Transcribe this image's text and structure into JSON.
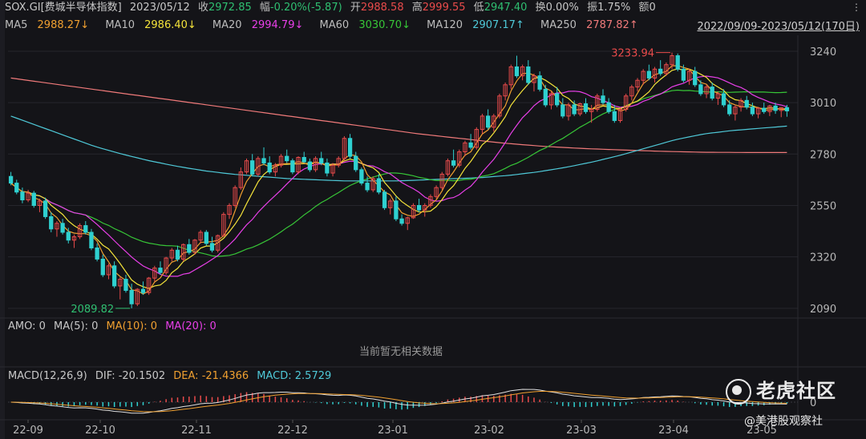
{
  "info": {
    "symbol": "SOX.GI[费城半导体指数]",
    "date": "2023/05/12",
    "close_label": "收",
    "close": "2972.85",
    "change_label": "幅",
    "change": "-0.20%(-5.87)",
    "open_label": "开",
    "open": "2988.58",
    "high_label": "高",
    "high": "2999.55",
    "low_label": "低",
    "low": "2947.40",
    "turnover_label": "换",
    "turnover": "0.00%",
    "amplitude_label": "振",
    "amplitude": "1.75%",
    "amount_label": "额",
    "amount": "0"
  },
  "ma": [
    {
      "label": "MA5",
      "value": "2988.27↓",
      "color": "#f0a030"
    },
    {
      "label": "MA10",
      "value": "2986.40↓",
      "color": "#f3e23a"
    },
    {
      "label": "MA20",
      "value": "2994.79↓",
      "color": "#e83fe8"
    },
    {
      "label": "MA60",
      "value": "3030.70↓",
      "color": "#37c637"
    },
    {
      "label": "MA120",
      "value": "2907.17↑",
      "color": "#4fc9d8"
    },
    {
      "label": "MA250",
      "value": "2787.82↑",
      "color": "#f07a7a"
    }
  ],
  "range": "2022/09/09-2023/05/12(170日)",
  "price_axis": [
    "3240",
    "3010",
    "2780",
    "2550",
    "2320",
    "2090"
  ],
  "annotations": {
    "high": "3233.94",
    "low": "2089.82"
  },
  "amo": {
    "label": "AMO: 0",
    "ma5": "MA(5): 0",
    "ma10": "MA(10): 0",
    "ma20": "MA(20): 0"
  },
  "amo_empty": "当前暂无相关数据",
  "macd": {
    "title": "MACD(12,26,9)",
    "dif": "DIF: -20.1502",
    "dea": "DEA: -21.4366",
    "macd": "MACD: 2.5729",
    "axis_zero": "0"
  },
  "x_axis": [
    "22-09",
    "22-10",
    "22-11",
    "22-12",
    "23-01",
    "23-02",
    "23-03",
    "23-04",
    "23-05"
  ],
  "watermark": {
    "brand": "老虎社区",
    "author": "@美港股观察社"
  },
  "colors": {
    "up": "#e94b4b",
    "down": "#2fd0d0",
    "bg": "#141418"
  },
  "chart_data": {
    "type": "candlestick",
    "ylim": [
      2050,
      3290
    ],
    "candles": [
      [
        2680,
        2700,
        2640,
        2650
      ],
      [
        2650,
        2665,
        2600,
        2610
      ],
      [
        2610,
        2630,
        2560,
        2575
      ],
      [
        2575,
        2620,
        2565,
        2605
      ],
      [
        2605,
        2615,
        2540,
        2550
      ],
      [
        2550,
        2580,
        2520,
        2570
      ],
      [
        2570,
        2585,
        2490,
        2500
      ],
      [
        2500,
        2520,
        2430,
        2445
      ],
      [
        2445,
        2480,
        2410,
        2470
      ],
      [
        2470,
        2490,
        2420,
        2430
      ],
      [
        2430,
        2450,
        2380,
        2395
      ],
      [
        2395,
        2420,
        2360,
        2410
      ],
      [
        2410,
        2470,
        2400,
        2460
      ],
      [
        2460,
        2480,
        2420,
        2430
      ],
      [
        2430,
        2445,
        2350,
        2360
      ],
      [
        2360,
        2380,
        2300,
        2310
      ],
      [
        2310,
        2330,
        2230,
        2240
      ],
      [
        2240,
        2290,
        2220,
        2280
      ],
      [
        2280,
        2300,
        2180,
        2190
      ],
      [
        2190,
        2230,
        2130,
        2220
      ],
      [
        2220,
        2240,
        2160,
        2170
      ],
      [
        2170,
        2200,
        2090,
        2110
      ],
      [
        2110,
        2180,
        2100,
        2175
      ],
      [
        2175,
        2210,
        2150,
        2160
      ],
      [
        2160,
        2230,
        2150,
        2225
      ],
      [
        2225,
        2280,
        2210,
        2270
      ],
      [
        2270,
        2300,
        2240,
        2250
      ],
      [
        2250,
        2320,
        2240,
        2315
      ],
      [
        2315,
        2360,
        2300,
        2350
      ],
      [
        2350,
        2370,
        2300,
        2310
      ],
      [
        2310,
        2380,
        2300,
        2375
      ],
      [
        2375,
        2400,
        2330,
        2340
      ],
      [
        2340,
        2400,
        2330,
        2395
      ],
      [
        2395,
        2440,
        2380,
        2430
      ],
      [
        2430,
        2440,
        2370,
        2380
      ],
      [
        2380,
        2410,
        2340,
        2350
      ],
      [
        2350,
        2420,
        2340,
        2415
      ],
      [
        2415,
        2520,
        2410,
        2510
      ],
      [
        2510,
        2560,
        2490,
        2550
      ],
      [
        2550,
        2640,
        2540,
        2630
      ],
      [
        2630,
        2720,
        2620,
        2700
      ],
      [
        2700,
        2760,
        2690,
        2750
      ],
      [
        2750,
        2780,
        2680,
        2690
      ],
      [
        2690,
        2770,
        2680,
        2760
      ],
      [
        2760,
        2810,
        2730,
        2740
      ],
      [
        2740,
        2770,
        2690,
        2700
      ],
      [
        2700,
        2740,
        2680,
        2730
      ],
      [
        2730,
        2780,
        2720,
        2770
      ],
      [
        2770,
        2800,
        2740,
        2750
      ],
      [
        2750,
        2760,
        2690,
        2700
      ],
      [
        2700,
        2770,
        2690,
        2765
      ],
      [
        2765,
        2790,
        2740,
        2745
      ],
      [
        2745,
        2760,
        2700,
        2710
      ],
      [
        2710,
        2770,
        2700,
        2760
      ],
      [
        2760,
        2790,
        2730,
        2740
      ],
      [
        2740,
        2760,
        2680,
        2695
      ],
      [
        2695,
        2740,
        2680,
        2730
      ],
      [
        2730,
        2770,
        2720,
        2760
      ],
      [
        2760,
        2860,
        2750,
        2850
      ],
      [
        2850,
        2870,
        2760,
        2770
      ],
      [
        2770,
        2790,
        2700,
        2710
      ],
      [
        2710,
        2720,
        2640,
        2650
      ],
      [
        2650,
        2680,
        2610,
        2620
      ],
      [
        2620,
        2680,
        2610,
        2670
      ],
      [
        2670,
        2690,
        2600,
        2610
      ],
      [
        2610,
        2620,
        2530,
        2540
      ],
      [
        2540,
        2580,
        2510,
        2570
      ],
      [
        2570,
        2590,
        2480,
        2490
      ],
      [
        2490,
        2510,
        2460,
        2470
      ],
      [
        2470,
        2500,
        2440,
        2495
      ],
      [
        2495,
        2560,
        2490,
        2550
      ],
      [
        2550,
        2580,
        2520,
        2530
      ],
      [
        2530,
        2560,
        2500,
        2550
      ],
      [
        2550,
        2600,
        2540,
        2590
      ],
      [
        2590,
        2640,
        2580,
        2630
      ],
      [
        2630,
        2700,
        2620,
        2690
      ],
      [
        2690,
        2760,
        2680,
        2750
      ],
      [
        2750,
        2800,
        2720,
        2730
      ],
      [
        2730,
        2800,
        2720,
        2790
      ],
      [
        2790,
        2840,
        2770,
        2830
      ],
      [
        2830,
        2870,
        2800,
        2810
      ],
      [
        2810,
        2900,
        2800,
        2890
      ],
      [
        2890,
        2960,
        2870,
        2950
      ],
      [
        2950,
        2980,
        2890,
        2900
      ],
      [
        2900,
        2960,
        2880,
        2950
      ],
      [
        2950,
        3050,
        2940,
        3040
      ],
      [
        3040,
        3100,
        3020,
        3090
      ],
      [
        3090,
        3180,
        3070,
        3170
      ],
      [
        3170,
        3220,
        3120,
        3130
      ],
      [
        3130,
        3180,
        3110,
        3170
      ],
      [
        3170,
        3200,
        3090,
        3100
      ],
      [
        3100,
        3140,
        3060,
        3130
      ],
      [
        3130,
        3150,
        3060,
        3070
      ],
      [
        3070,
        3090,
        2990,
        3000
      ],
      [
        3000,
        3060,
        2980,
        3050
      ],
      [
        3050,
        3080,
        2990,
        3000
      ],
      [
        3000,
        3030,
        2940,
        2950
      ],
      [
        2950,
        3010,
        2930,
        3000
      ],
      [
        3000,
        3020,
        2950,
        2960
      ],
      [
        2960,
        3010,
        2950,
        3005
      ],
      [
        3005,
        3030,
        2960,
        2970
      ],
      [
        2970,
        3000,
        2920,
        2980
      ],
      [
        2980,
        3050,
        2970,
        3040
      ],
      [
        3040,
        3070,
        3000,
        3010
      ],
      [
        3010,
        3030,
        2960,
        2970
      ],
      [
        2970,
        3000,
        2920,
        2930
      ],
      [
        2930,
        2990,
        2920,
        2980
      ],
      [
        2980,
        3050,
        2970,
        3040
      ],
      [
        3040,
        3090,
        3020,
        3080
      ],
      [
        3080,
        3120,
        3060,
        3110
      ],
      [
        3110,
        3160,
        3090,
        3150
      ],
      [
        3150,
        3180,
        3110,
        3120
      ],
      [
        3120,
        3170,
        3100,
        3160
      ],
      [
        3160,
        3200,
        3130,
        3140
      ],
      [
        3140,
        3190,
        3130,
        3180
      ],
      [
        3180,
        3234,
        3160,
        3220
      ],
      [
        3220,
        3230,
        3150,
        3160
      ],
      [
        3160,
        3180,
        3100,
        3110
      ],
      [
        3110,
        3160,
        3090,
        3150
      ],
      [
        3150,
        3170,
        3080,
        3090
      ],
      [
        3090,
        3110,
        3040,
        3050
      ],
      [
        3050,
        3090,
        3030,
        3080
      ],
      [
        3080,
        3100,
        3020,
        3030
      ],
      [
        3030,
        3060,
        3000,
        3050
      ],
      [
        3050,
        3070,
        2990,
        3000
      ],
      [
        3000,
        3020,
        2950,
        2960
      ],
      [
        2960,
        3000,
        2930,
        2990
      ],
      [
        2990,
        3030,
        2970,
        3020
      ],
      [
        3020,
        3040,
        2980,
        2990
      ],
      [
        2990,
        3010,
        2950,
        2960
      ],
      [
        2960,
        2990,
        2940,
        2985
      ],
      [
        2985,
        3010,
        2960,
        2970
      ],
      [
        2970,
        3000,
        2950,
        2995
      ],
      [
        2995,
        3010,
        2960,
        2975
      ],
      [
        2975,
        2990,
        2945,
        2988
      ],
      [
        2988,
        3000,
        2947,
        2973
      ]
    ],
    "ma120": [
      2950,
      2905,
      2860,
      2815,
      2780,
      2750,
      2725,
      2705,
      2690,
      2680,
      2670,
      2665,
      2660,
      2660,
      2660,
      2665,
      2670,
      2675,
      2685,
      2700,
      2720,
      2745,
      2775,
      2810,
      2845,
      2870,
      2885,
      2895,
      2905
    ],
    "ma250": [
      3120,
      3095,
      3070,
      3045,
      3020,
      2995,
      2970,
      2945,
      2920,
      2895,
      2870,
      2850,
      2830,
      2815,
      2805,
      2798,
      2792,
      2788,
      2787,
      2787
    ]
  }
}
